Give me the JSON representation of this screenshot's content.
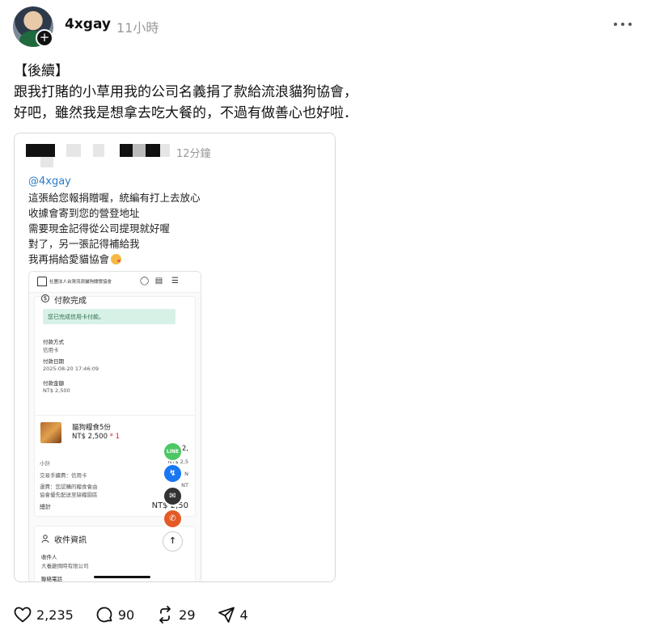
{
  "header": {
    "username": "4xgay",
    "timeago": "11小時"
  },
  "post": {
    "lines": [
      "【後續】",
      "跟我打賭的小草用我的公司名義捐了款給流浪貓狗協會，",
      "好吧，雖然我是想拿去吃大餐的，不過有做善心也好啦．"
    ]
  },
  "embed": {
    "timeago": "12分鐘",
    "mention": "@4xgay",
    "lines": [
      "這張給您報捐贈喔，統編有打上去放心",
      "收據會寄到您的營登地址",
      "需要現金記得從公司提現就好喔",
      "對了，另一張記得補給我",
      "我再捐給愛貓協會"
    ]
  },
  "phone": {
    "brand": "社團法人台灣流浪貓狗關懷協會",
    "payment": {
      "title": "付款完成",
      "success": "您已完成信用卡付款。",
      "method_label": "付款方式",
      "method_value": "信用卡",
      "date_label": "付款日期",
      "date_value": "2025-08-20 17:46:09",
      "amount_label": "付款金額",
      "amount_value": "NT$ 2,500"
    },
    "order": {
      "item_name": "貓狗糧食5份",
      "item_price": "NT$ 2,500",
      "item_qty": "* 1",
      "item_total": "NT$ 2,",
      "subtotal_label": "小計",
      "subtotal_value": "NT$ 2,5",
      "fee_label": "交易手續費：信用卡",
      "fee_value": "N",
      "shipping_label_1": "運費：您認購的糧食會由",
      "shipping_label_2": "協會優先配送至缺糧園區",
      "shipping_value": "NT",
      "total_label": "總計",
      "total_value": "NT$ 2,50"
    },
    "receiver": {
      "title": "收件資訊",
      "name_label": "收件人",
      "name_value": "大養雞惆時有限公司",
      "phone_label": "聯絡電話"
    },
    "fabs": {
      "line": "LINE"
    }
  },
  "actions": {
    "likes": "2,235",
    "comments": "90",
    "reposts": "29",
    "shares": "4"
  }
}
